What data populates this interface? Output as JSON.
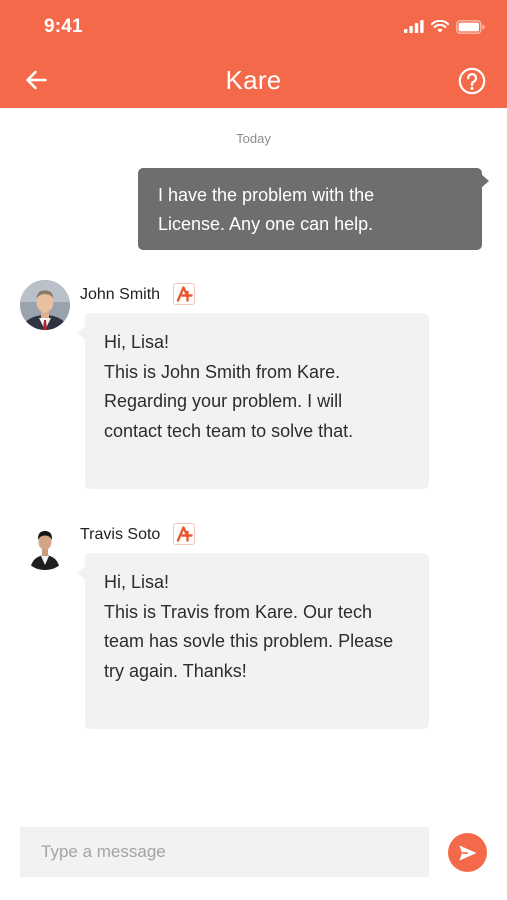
{
  "status_bar": {
    "time": "9:41",
    "icons": [
      "signal-icon",
      "wifi-icon",
      "battery-icon"
    ]
  },
  "header": {
    "title": "Kare",
    "back_icon": "arrow-left-icon",
    "help_icon": "question-circle-icon"
  },
  "chat": {
    "date_label": "Today",
    "outgoing_message": {
      "lines": [
        "I have the problem with the",
        "License. Any one can help."
      ]
    },
    "incoming_messages": [
      {
        "sender": "John Smith",
        "badge_icon": "kare-logo-icon",
        "lines": [
          "Hi, Lisa!",
          "This is John Smith from Kare.",
          "Regarding your problem. I will",
          "contact tech team to solve that."
        ]
      },
      {
        "sender": "Travis Soto",
        "badge_icon": "kare-logo-icon",
        "lines": [
          "Hi, Lisa!",
          "This is Travis from Kare. Our tech",
          "team has sovle this problem. Please",
          "try again. Thanks!"
        ]
      }
    ]
  },
  "composer": {
    "value": "",
    "placeholder": "Type a message",
    "send_icon": "send-icon"
  },
  "colors": {
    "brand": "#F4694A",
    "outgoing_bubble": "#6E6E6E",
    "incoming_bubble": "#F2F2F2"
  }
}
